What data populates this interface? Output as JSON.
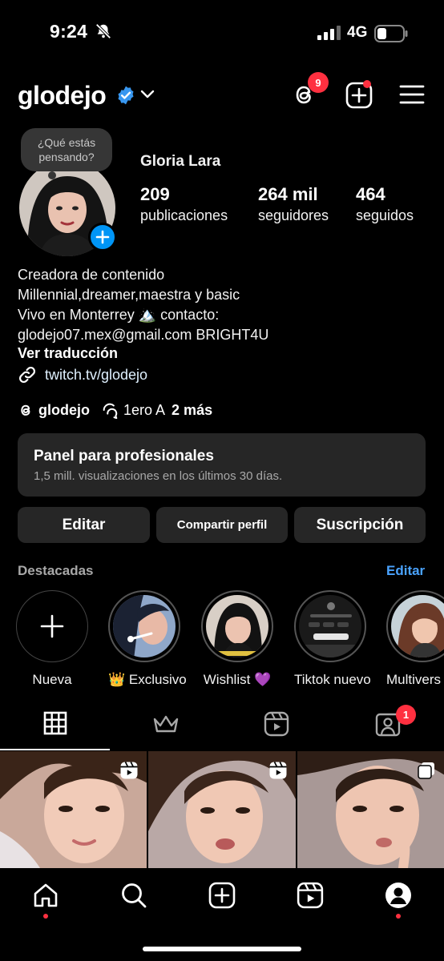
{
  "status_bar": {
    "time": "9:24",
    "network": "4G"
  },
  "header": {
    "username": "glodejo",
    "threads_badge": "9"
  },
  "profile": {
    "note": "¿Qué estás pensando?",
    "full_name": "Gloria Lara",
    "stats": [
      {
        "value": "209",
        "label": "publicaciones"
      },
      {
        "value": "264 mil",
        "label": "seguidores"
      },
      {
        "value": "464",
        "label": "seguidos"
      }
    ],
    "bio": [
      "Creadora de contenido",
      "Millennial,dreamer,maestra y basic",
      "Vivo en Monterrey 🏔️ contacto:",
      "glodejo07.mex@gmail.com BRIGHT4U"
    ],
    "translate": "Ver traducción",
    "link": "twitch.tv/glodejo",
    "chips": {
      "threads": "glodejo",
      "channel": "1ero A",
      "more": "2 más"
    }
  },
  "pro_panel": {
    "title": "Panel para profesionales",
    "subtitle": "1,5 mill. visualizaciones en los últimos 30 días."
  },
  "buttons": {
    "edit": "Editar",
    "share": "Compartir perfil",
    "subscription": "Suscripción"
  },
  "highlights": {
    "title": "Destacadas",
    "edit": "Editar",
    "items": [
      {
        "label": "Nueva"
      },
      {
        "label": "👑 Exclusivo"
      },
      {
        "label": "Wishlist 💜"
      },
      {
        "label": "Tiktok nuevo"
      },
      {
        "label": "Multivers"
      }
    ]
  },
  "tabs": {
    "tagged_badge": "1"
  },
  "colors": {
    "accent": "#0095f6",
    "badge": "#ff3040",
    "panel": "#262626",
    "link": "#4aa3ff"
  }
}
